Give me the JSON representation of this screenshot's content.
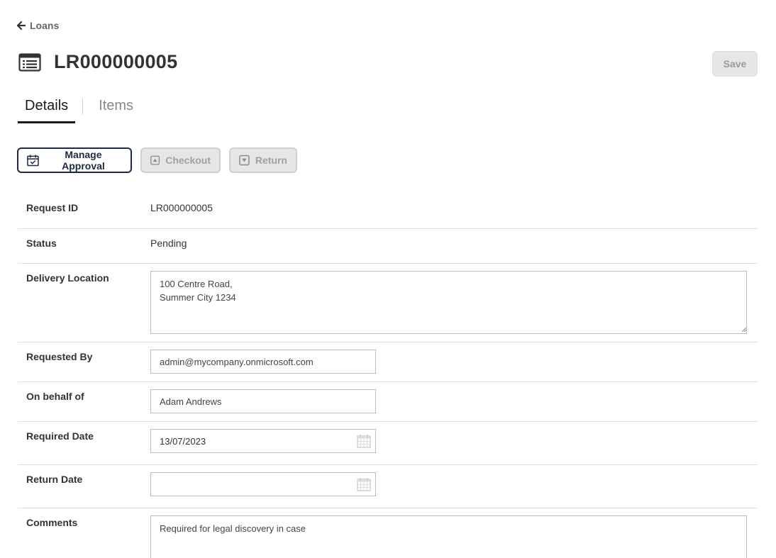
{
  "breadcrumb": {
    "back_label": "Loans"
  },
  "header": {
    "title": "LR000000005",
    "save_label": "Save"
  },
  "tabs": [
    {
      "label": "Details",
      "active": true
    },
    {
      "label": "Items",
      "active": false
    }
  ],
  "actions": {
    "manage_approval": "Manage Approval",
    "checkout": "Checkout",
    "return": "Return"
  },
  "fields": {
    "request_id": {
      "label": "Request ID",
      "value": "LR000000005"
    },
    "status": {
      "label": "Status",
      "value": "Pending"
    },
    "delivery_location": {
      "label": "Delivery Location",
      "value": "100 Centre Road,\nSummer City 1234"
    },
    "requested_by": {
      "label": "Requested By",
      "value": "admin@mycompany.onmicrosoft.com"
    },
    "on_behalf_of": {
      "label": "On behalf of",
      "value": "Adam Andrews"
    },
    "required_date": {
      "label": "Required Date",
      "value": "13/07/2023"
    },
    "return_date": {
      "label": "Return Date",
      "value": ""
    },
    "comments": {
      "label": "Comments",
      "value": "Required for legal discovery in case"
    }
  },
  "colors": {
    "primary_border": "#1c2940",
    "disabled_bg": "#e6e6e6",
    "divider": "#dddddd",
    "tab_active": "#1a1a1a"
  },
  "icons": {
    "back": "arrow-left-icon",
    "title": "list-icon",
    "manage_approval": "calendar-check-icon",
    "checkout": "arrow-up-square-icon",
    "return": "arrow-down-square-icon",
    "date": "calendar-icon"
  }
}
